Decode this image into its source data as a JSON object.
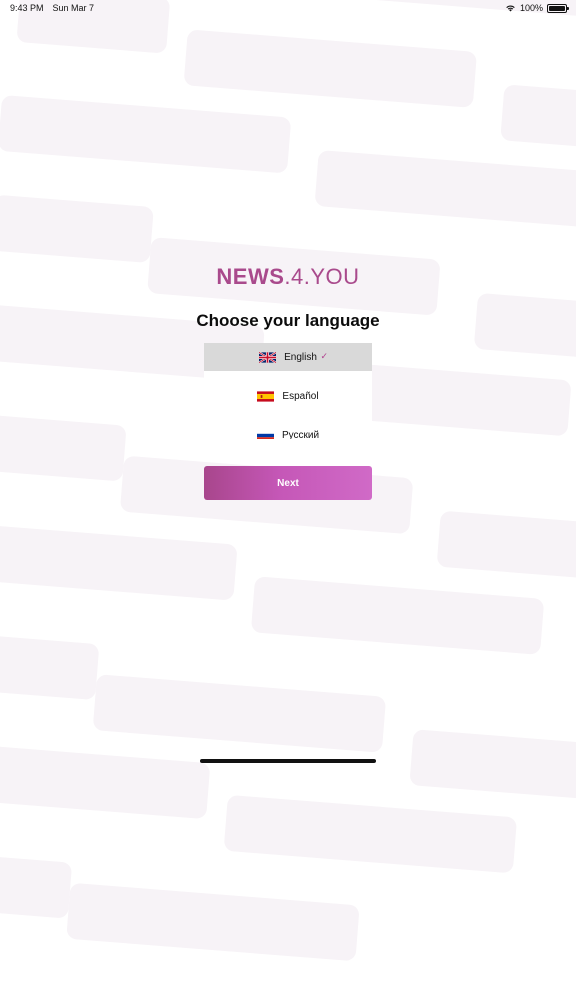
{
  "status_bar": {
    "time": "9:43 PM",
    "date": "Sun Mar 7",
    "battery": "100%",
    "wifi_icon": "wifi-icon",
    "battery_icon": "battery-icon"
  },
  "logo": {
    "part1": "NEWS",
    "part2": ".4.YOU",
    "color": "#a94a8c"
  },
  "title": "Choose your language",
  "languages": [
    {
      "label": "English",
      "flag": "uk-flag-icon",
      "selected": true
    },
    {
      "label": "Español",
      "flag": "spain-flag-icon",
      "selected": false
    },
    {
      "label": "Русский",
      "flag": "russia-flag-icon",
      "selected": false
    }
  ],
  "next_button": {
    "label": "Next",
    "gradient": [
      "#a8468c",
      "#d06ac7"
    ]
  },
  "colors": {
    "background_brick": "#f7f3f7",
    "selected_row": "#d9d9d9",
    "check_mark": "#b0418e"
  }
}
